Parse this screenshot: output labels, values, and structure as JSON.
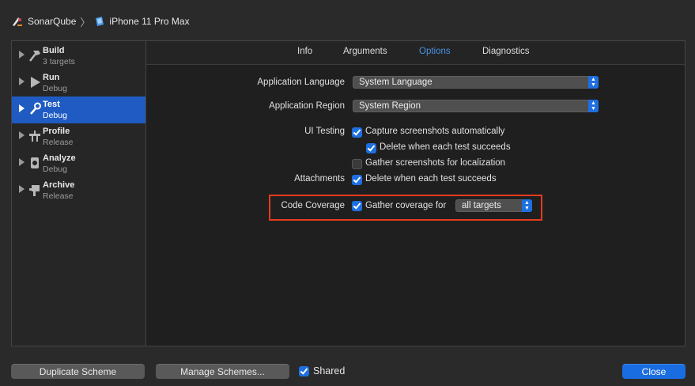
{
  "breadcrumb": {
    "project": "SonarQube",
    "device": "iPhone 11 Pro Max",
    "project_icon": "xcode-app-icon",
    "device_icon": "iphone-device-icon"
  },
  "sidebar": {
    "items": [
      {
        "name": "Build",
        "sub": "3 targets",
        "icon": "hammer-icon",
        "selected": false
      },
      {
        "name": "Run",
        "sub": "Debug",
        "icon": "play-icon",
        "selected": false
      },
      {
        "name": "Test",
        "sub": "Debug",
        "icon": "wrench-icon",
        "selected": true
      },
      {
        "name": "Profile",
        "sub": "Release",
        "icon": "gauge-icon",
        "selected": false
      },
      {
        "name": "Analyze",
        "sub": "Debug",
        "icon": "analyze-icon",
        "selected": false
      },
      {
        "name": "Archive",
        "sub": "Release",
        "icon": "archive-icon",
        "selected": false
      }
    ]
  },
  "tabs": [
    "Info",
    "Arguments",
    "Options",
    "Diagnostics"
  ],
  "active_tab": "Options",
  "options": {
    "app_language_label": "Application Language",
    "app_language_value": "System Language",
    "app_region_label": "Application Region",
    "app_region_value": "System Region",
    "ui_testing_label": "UI Testing",
    "capture_screenshots": "Capture screenshots automatically",
    "delete_when_succeeds": "Delete when each test succeeds",
    "gather_localization": "Gather screenshots for localization",
    "attachments_label": "Attachments",
    "attachments_delete": "Delete when each test succeeds",
    "code_coverage_label": "Code Coverage",
    "gather_coverage": "Gather coverage for",
    "coverage_targets": "all targets"
  },
  "footer": {
    "duplicate": "Duplicate Scheme",
    "manage": "Manage Schemes...",
    "shared": "Shared",
    "close": "Close"
  },
  "colors": {
    "accent": "#1e6fe0",
    "selection": "#1f5bc2",
    "highlight_box": "#e53b1e",
    "active_tab": "#4a90e2"
  }
}
